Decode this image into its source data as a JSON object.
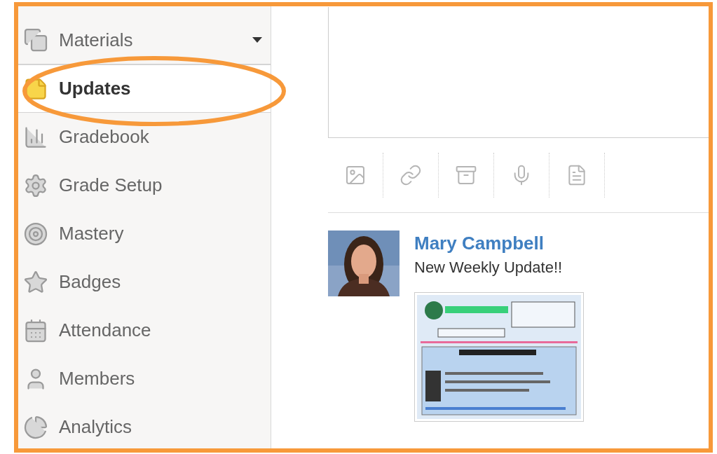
{
  "sidebar": {
    "items": [
      {
        "label": "Materials",
        "selected": false,
        "has_menu": true
      },
      {
        "label": "Updates",
        "selected": true,
        "has_menu": false
      },
      {
        "label": "Gradebook",
        "selected": false,
        "has_menu": false
      },
      {
        "label": "Grade Setup",
        "selected": false,
        "has_menu": false
      },
      {
        "label": "Mastery",
        "selected": false,
        "has_menu": false
      },
      {
        "label": "Badges",
        "selected": false,
        "has_menu": false
      },
      {
        "label": "Attendance",
        "selected": false,
        "has_menu": false
      },
      {
        "label": "Members",
        "selected": false,
        "has_menu": false
      },
      {
        "label": "Analytics",
        "selected": false,
        "has_menu": false
      }
    ]
  },
  "post": {
    "author": "Mary Campbell",
    "text": "New Weekly Update!!"
  }
}
